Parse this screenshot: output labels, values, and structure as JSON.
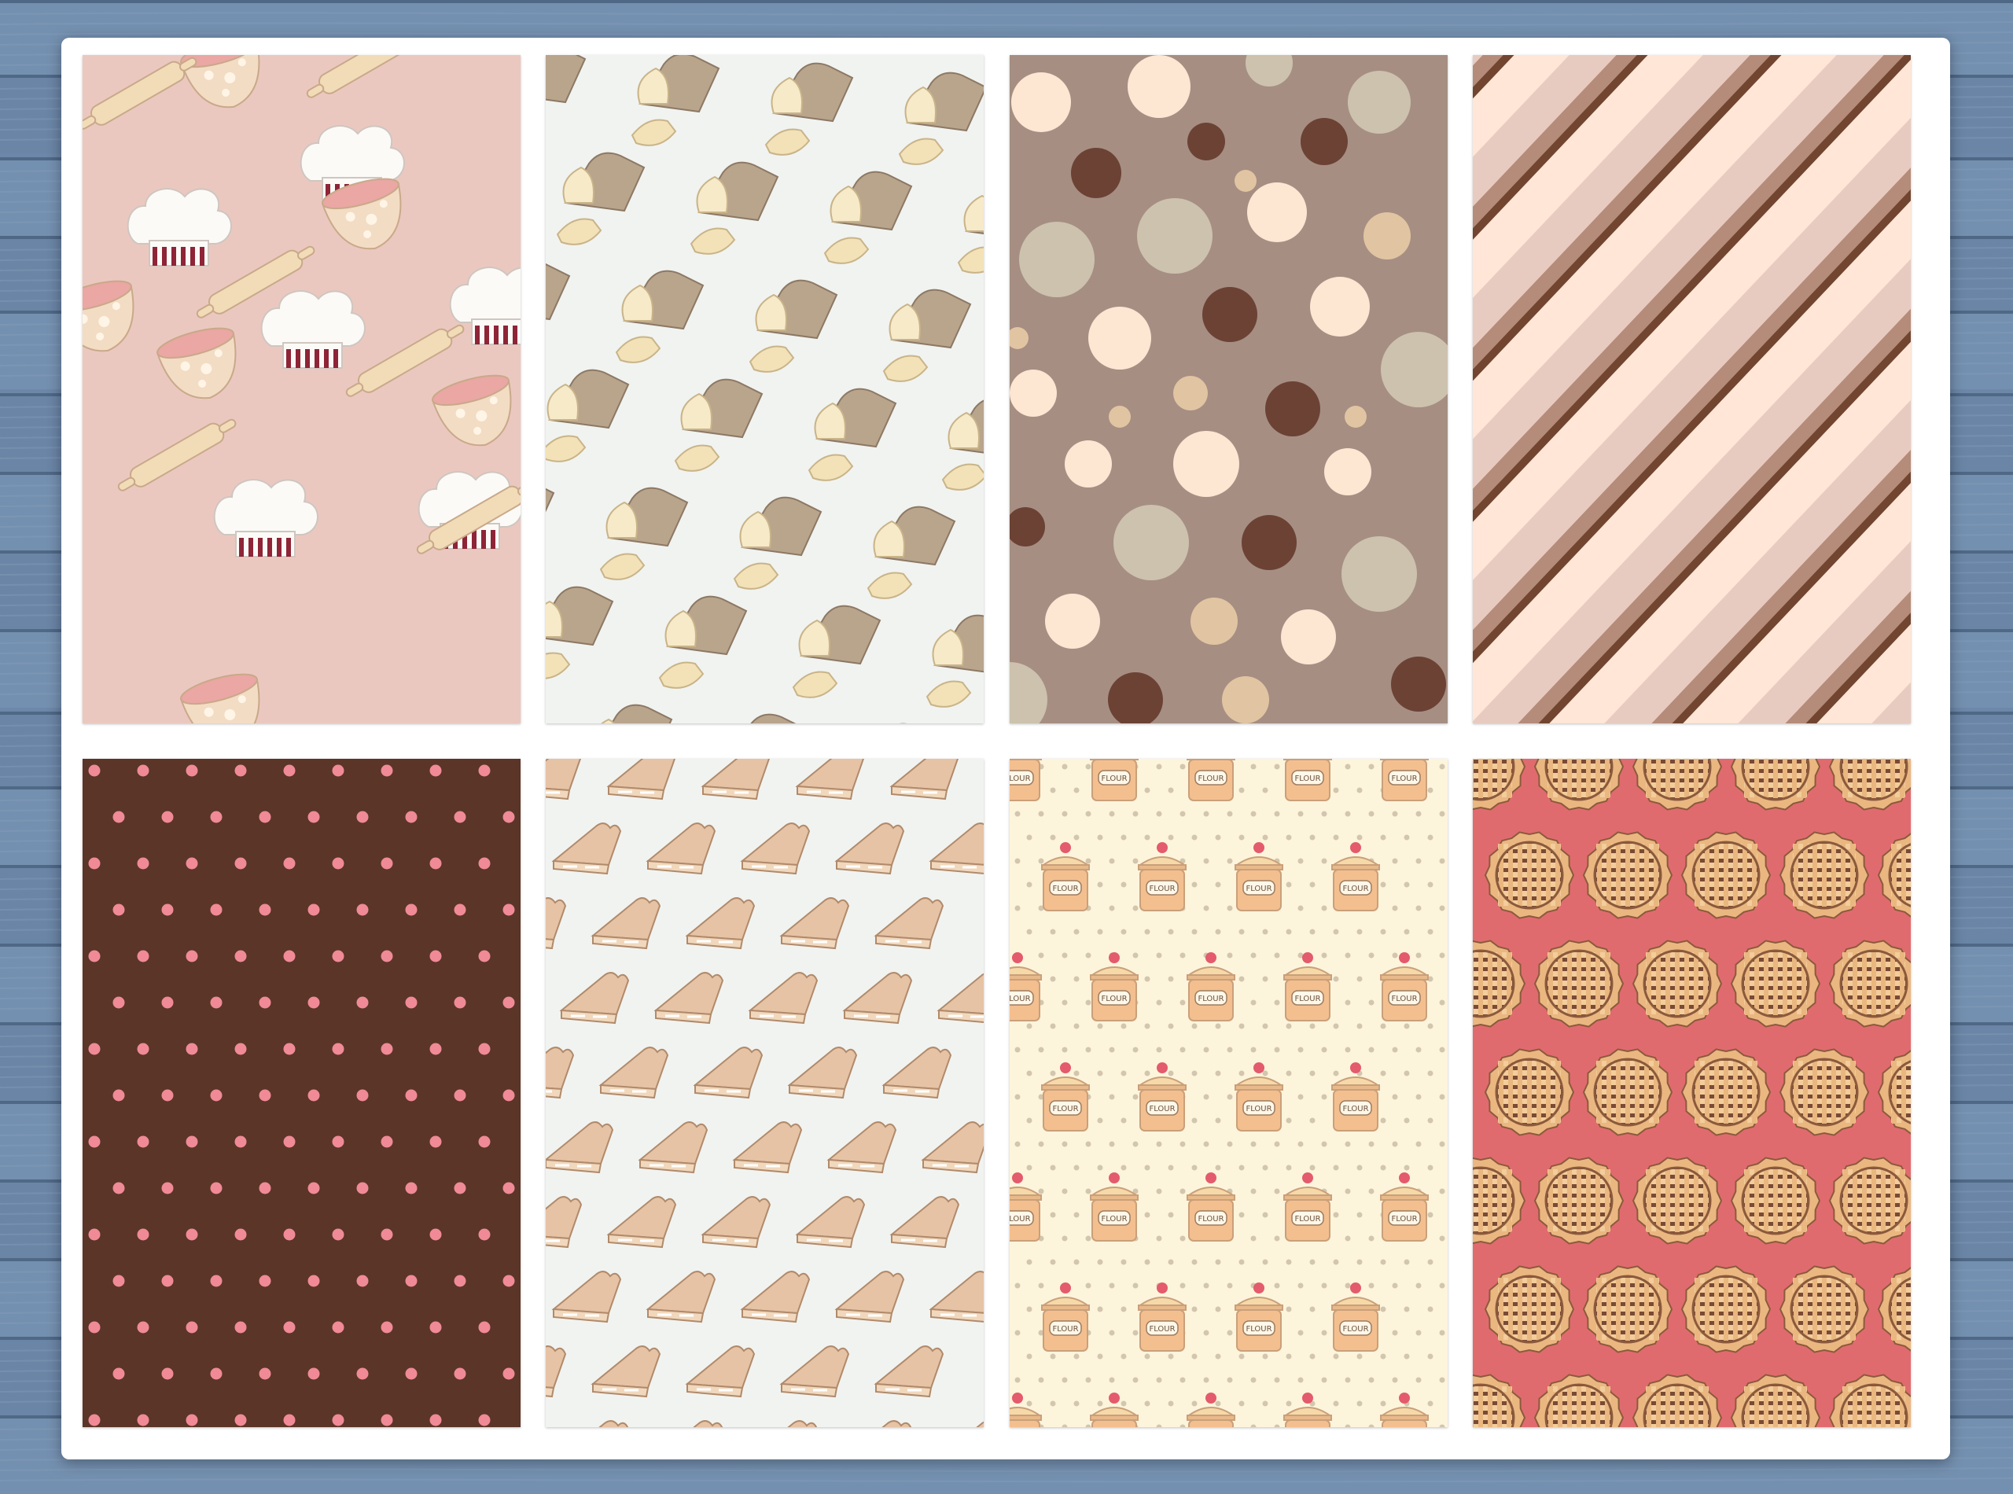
{
  "colors": {
    "wood": "#6c87a8",
    "board": "#ffffff"
  },
  "papers": [
    {
      "id": "chef-hats",
      "background": "#ebc8bf",
      "icons": [
        "chef-hat-icon",
        "mixing-bowl-icon",
        "rolling-pin-icon"
      ]
    },
    {
      "id": "bread-loaves",
      "background": "#f1f3f0",
      "icons": [
        "bread-loaf-icon"
      ]
    },
    {
      "id": "big-polka-dots",
      "background": "#a68e83",
      "colors": [
        "#fde6d2",
        "#6b4234",
        "#ccc2ad",
        "#e1c5a2"
      ]
    },
    {
      "id": "diagonal-stripes",
      "background": "#ffe6d6",
      "colors": [
        "#ffe6d6",
        "#e8cbc0",
        "#b58b79",
        "#71452f"
      ]
    },
    {
      "id": "pink-dots",
      "background": "#5a3528",
      "dot": "#f08a96"
    },
    {
      "id": "pie-slices",
      "background": "#f1f3f0",
      "icons": [
        "pie-slice-icon"
      ]
    },
    {
      "id": "flour-jars",
      "background": "#fdf4dc",
      "label": "FLOUR",
      "icons": [
        "flour-jar-icon"
      ]
    },
    {
      "id": "lattice-pies",
      "background": "#e06b6e",
      "icons": [
        "lattice-pie-icon"
      ]
    }
  ]
}
